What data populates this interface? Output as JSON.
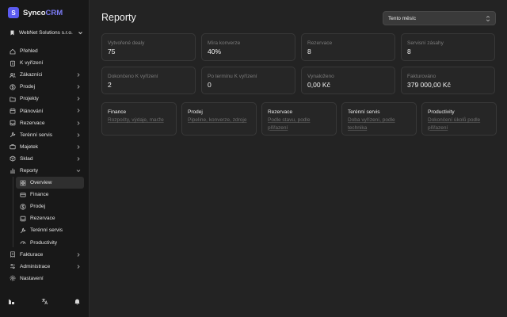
{
  "brand": {
    "logo_letter": "S",
    "name_part1": "Synco",
    "name_part2": "CRM",
    "accent": "#5b5bf0"
  },
  "org": {
    "name": "WebNet Solutions s.r.o."
  },
  "nav": {
    "items": [
      {
        "label": "Přehled",
        "icon": "home-icon"
      },
      {
        "label": "K vyřízení",
        "icon": "clipboard-icon"
      },
      {
        "label": "Zákazníci",
        "icon": "users-icon"
      },
      {
        "label": "Prodej",
        "icon": "dollar-icon"
      },
      {
        "label": "Projekty",
        "icon": "folder-icon"
      },
      {
        "label": "Plánování",
        "icon": "calendar-icon"
      },
      {
        "label": "Rezervace",
        "icon": "inbox-icon"
      },
      {
        "label": "Terénní servis",
        "icon": "wrench-icon"
      },
      {
        "label": "Majetek",
        "icon": "briefcase-icon"
      },
      {
        "label": "Sklad",
        "icon": "box-icon"
      },
      {
        "label": "Reporty",
        "icon": "bar-chart-icon"
      }
    ],
    "sub_items": [
      {
        "label": "Overview",
        "icon": "grid-icon"
      },
      {
        "label": "Finance",
        "icon": "card-icon"
      },
      {
        "label": "Prodej",
        "icon": "dollar-icon"
      },
      {
        "label": "Rezervace",
        "icon": "inbox-icon"
      },
      {
        "label": "Terénní servis",
        "icon": "wrench-icon"
      },
      {
        "label": "Productivity",
        "icon": "gauge-icon"
      }
    ],
    "bottom_items": [
      {
        "label": "Fakturace",
        "icon": "receipt-icon"
      },
      {
        "label": "Administrace",
        "icon": "sliders-icon"
      },
      {
        "label": "Nastavení",
        "icon": "gear-icon"
      }
    ]
  },
  "footer": {
    "icons": [
      "dashboard-icon",
      "translate-icon",
      "bell-icon"
    ]
  },
  "page": {
    "title": "Reporty",
    "period": "Tento měsíc"
  },
  "stats": [
    {
      "label": "Vytvořené dealy",
      "value": "75"
    },
    {
      "label": "Míra konverze",
      "value": "40%"
    },
    {
      "label": "Rezervace",
      "value": "8"
    },
    {
      "label": "Servisní zásahy",
      "value": "8"
    },
    {
      "label": "Dokončeno K vyřízení",
      "value": "2"
    },
    {
      "label": "Po termínu K vyřízení",
      "value": "0"
    },
    {
      "label": "Vynaloženo",
      "value": "0,00 Kč"
    },
    {
      "label": "Fakturováno",
      "value": "379 000,00 Kč"
    }
  ],
  "reports": [
    {
      "title": "Finance",
      "desc": "Rozpočty, výdaje, marže"
    },
    {
      "title": "Prodej",
      "desc": "Pipeline, konverze, zdroje"
    },
    {
      "title": "Rezervace",
      "desc": "Podle stavu, podle přiřazení"
    },
    {
      "title": "Terénní servis",
      "desc": "Doba vyřízení, podle technika"
    },
    {
      "title": "Productivity",
      "desc": "Dokončení úkolů podle přiřazení"
    }
  ]
}
